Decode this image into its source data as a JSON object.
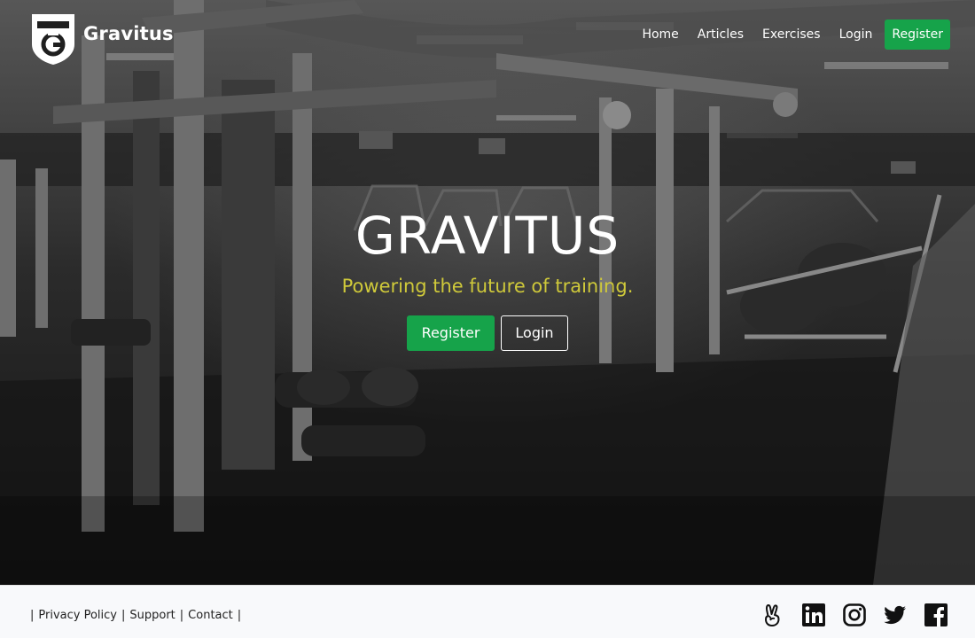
{
  "brand": {
    "name": "Gravitus"
  },
  "nav": {
    "items": [
      {
        "label": "Home"
      },
      {
        "label": "Articles"
      },
      {
        "label": "Exercises"
      },
      {
        "label": "Login"
      }
    ],
    "cta_label": "Register"
  },
  "hero": {
    "title": "GRAVITUS",
    "tagline": "Powering the future of training.",
    "primary_label": "Register",
    "secondary_label": "Login"
  },
  "footer": {
    "links": [
      {
        "label": "Privacy Policy"
      },
      {
        "label": "Support"
      },
      {
        "label": "Contact"
      }
    ],
    "separator": "|",
    "social": [
      "angellist-icon",
      "linkedin-icon",
      "instagram-icon",
      "twitter-icon",
      "facebook-icon"
    ]
  },
  "colors": {
    "accent_green": "#16a34a",
    "tagline_yellow": "#cfc93a",
    "footer_bg": "#f8f9fb"
  }
}
